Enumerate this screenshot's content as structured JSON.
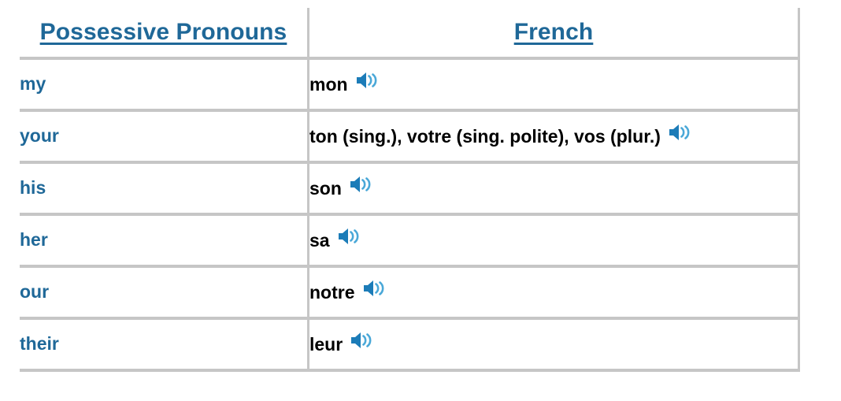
{
  "table": {
    "headers": [
      {
        "label": "Possessive Pronouns",
        "align": "center"
      },
      {
        "label": "French",
        "align": "center"
      }
    ],
    "rows": [
      {
        "english": "my",
        "french": "mon",
        "audio_icon": "speaker-icon"
      },
      {
        "english": "your",
        "french": "ton (sing.), votre (sing. polite), vos (plur.)",
        "audio_icon": "speaker-icon"
      },
      {
        "english": "his",
        "french": "son",
        "audio_icon": "speaker-icon"
      },
      {
        "english": "her",
        "french": "sa",
        "audio_icon": "speaker-icon"
      },
      {
        "english": "our",
        "french": "notre",
        "audio_icon": "speaker-icon"
      },
      {
        "english": "their",
        "french": "leur",
        "audio_icon": "speaker-icon"
      }
    ]
  },
  "colors": {
    "link_blue": "#1f6898",
    "speaker_dark": "#1c7cb8",
    "speaker_light": "#4aa8d8",
    "border_gray": "#c6c6c6",
    "text_black": "#000000",
    "background": "#ffffff"
  }
}
